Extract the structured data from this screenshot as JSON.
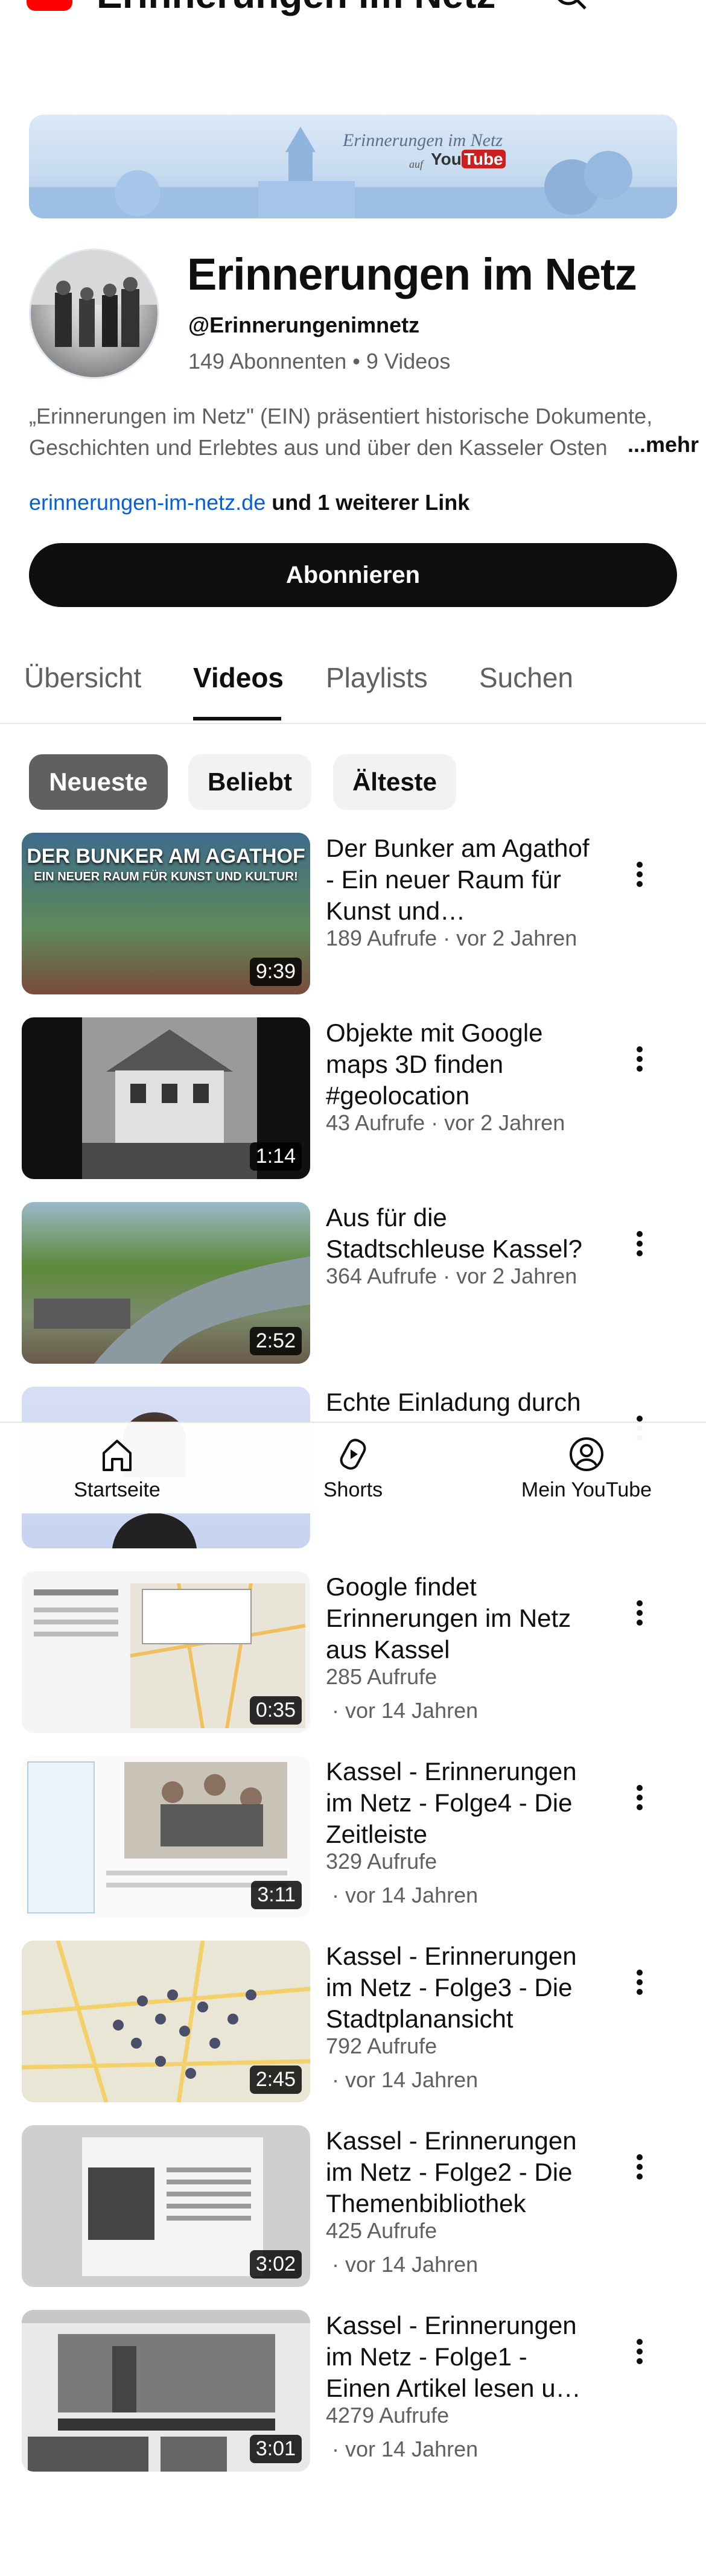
{
  "header": {
    "title": "Erinnerungen im Netz",
    "icons": [
      "youtube-logo-icon",
      "search-icon",
      "more-vert-icon"
    ]
  },
  "banner": {
    "title": "Erinnerungen im Netz",
    "auf": "auf",
    "you": "You",
    "tube": "Tube"
  },
  "channel": {
    "name": "Erinnerungen im Netz",
    "handle": "@Erinnerungenimnetz",
    "stats": "149 Abonnenten • 9 Videos",
    "description": "„Erinnerungen im Netz\" (EIN) präsentiert historische Dokumente, Geschichten und Erlebtes aus und über den Kasseler Osten",
    "more": "...mehr",
    "link": "erinnerungen-im-netz.de",
    "link_more": " und 1 weiterer Link",
    "subscribe": "Abonnieren"
  },
  "tabs": [
    "Übersicht",
    "Videos",
    "Playlists",
    "Suchen"
  ],
  "chips": [
    "Neueste",
    "Beliebt",
    "Älteste"
  ],
  "videos": [
    {
      "title": "Der Bunker am Agathof - Ein neuer Raum für Kunst und…",
      "meta": "189 Aufrufe · vor 2 Jahren",
      "meta2": "",
      "duration": "9:39",
      "thumb_text": "DER BUNKER AM AGATHOF",
      "thumb_sub": "EIN NEUER RAUM FÜR KUNST UND KULTUR!"
    },
    {
      "title": "Objekte mit Google maps 3D finden #geolocation",
      "meta": "43 Aufrufe · vor 2 Jahren",
      "meta2": "",
      "duration": "1:14"
    },
    {
      "title": "Aus für die Stadtschleuse Kassel?",
      "meta": "364 Aufrufe · vor 2 Jahren",
      "meta2": "",
      "duration": "2:52"
    },
    {
      "title": "Echte Einladung durch",
      "meta": "",
      "meta2": "",
      "duration": ""
    },
    {
      "title": "Google findet Erinnerungen im Netz aus Kassel",
      "meta": "285 Aufrufe",
      "meta2": "· vor 14 Jahren",
      "duration": "0:35"
    },
    {
      "title": "Kassel - Erinnerungen im Netz - Folge4 - Die Zeitleiste",
      "meta": "329 Aufrufe",
      "meta2": "· vor 14 Jahren",
      "duration": "3:11"
    },
    {
      "title": "Kassel - Erinnerungen im Netz - Folge3 - Die Stadtplanansicht",
      "meta": "792 Aufrufe",
      "meta2": "· vor 14 Jahren",
      "duration": "2:45"
    },
    {
      "title": "Kassel - Erinnerungen im Netz - Folge2 - Die Themenbibliothek",
      "meta": "425 Aufrufe",
      "meta2": "· vor 14 Jahren",
      "duration": "3:02"
    },
    {
      "title": "Kassel - Erinnerungen im Netz - Folge1 - Einen Artikel lesen u…",
      "meta": "4279 Aufrufe",
      "meta2": "· vor 14 Jahren",
      "duration": "3:01"
    }
  ],
  "bottom_nav": [
    "Startseite",
    "Shorts",
    "Mein YouTube"
  ]
}
